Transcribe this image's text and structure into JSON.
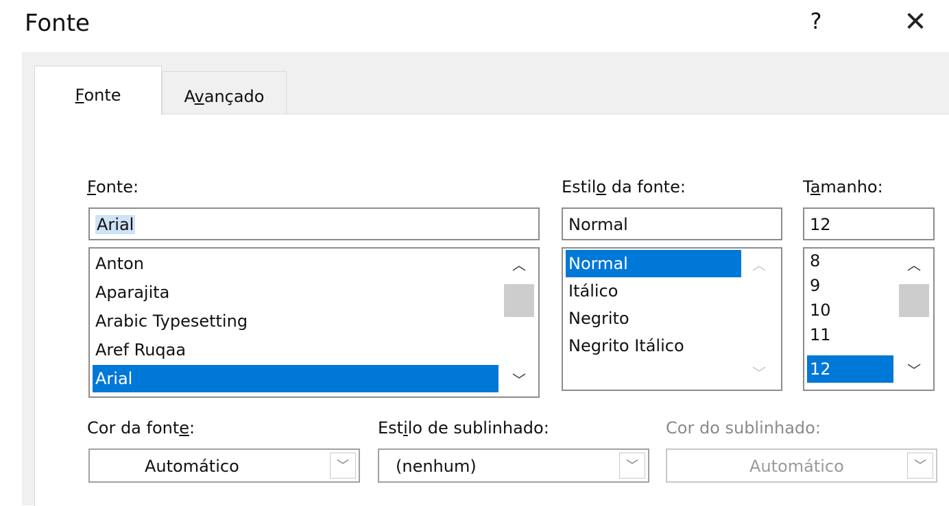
{
  "window": {
    "title": "Fonte",
    "help": "?",
    "close": "✕"
  },
  "tabs": [
    {
      "label": "Fonte",
      "accel": "F",
      "rest": "onte",
      "active": true
    },
    {
      "label": "Avançado",
      "pre": "A",
      "accel": "v",
      "rest": "ançado",
      "active": false
    }
  ],
  "font": {
    "label_accel": "F",
    "label_rest": "onte:",
    "value": "Arial",
    "list": [
      "Anton",
      "Aparajita",
      "Arabic Typesetting",
      "Aref Ruqaa",
      "Arial"
    ],
    "selected_index": 4
  },
  "style": {
    "label_pre": "Estil",
    "label_accel": "o",
    "label_rest": " da fonte:",
    "value": "Normal",
    "list": [
      "Normal",
      "Itálico",
      "Negrito",
      "Negrito Itálico"
    ],
    "selected_index": 0
  },
  "size": {
    "label_pre": "T",
    "label_accel": "a",
    "label_rest": "manho:",
    "value": "12",
    "list": [
      "8",
      "9",
      "10",
      "11",
      "12"
    ],
    "selected_index": 4
  },
  "font_color": {
    "label_pre": "Cor da font",
    "label_accel": "e",
    "label_rest": ":",
    "value": "Automático"
  },
  "underline_style": {
    "label_pre": "Est",
    "label_accel": "i",
    "label_rest": "lo de sublinhado:",
    "value": "(nenhum)"
  },
  "underline_color": {
    "label": "Cor do sublinhado:",
    "value": "Automático",
    "disabled": true
  },
  "icons": {
    "scroll_up": "chevron-up-icon",
    "scroll_down": "chevron-down-icon",
    "dropdown": "chevron-down-icon"
  },
  "colors": {
    "selection": "#0078d7",
    "dialog_bg": "#f0f0f0"
  }
}
